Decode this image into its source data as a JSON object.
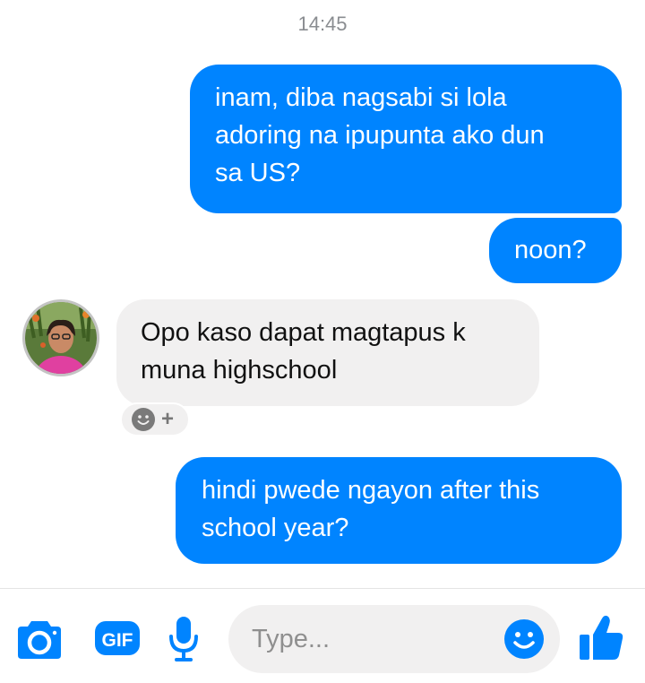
{
  "conversation": {
    "timestamp": "14:45",
    "messages": [
      {
        "direction": "outgoing",
        "lines": [
          "inam, diba nagsabi si lola",
          "adoring na ipupunta ako dun",
          "sa US?"
        ]
      },
      {
        "direction": "outgoing",
        "lines": [
          "noon?"
        ]
      },
      {
        "direction": "incoming",
        "lines": [
          "Opo kaso dapat magtapus k",
          "muna highschool"
        ]
      },
      {
        "direction": "outgoing",
        "lines": [
          "hindi pwede ngayon after this",
          "school year?"
        ]
      }
    ],
    "reaction_add_label": "+"
  },
  "composer": {
    "placeholder": "Type...",
    "gif_label": "GIF",
    "icons": [
      "camera-icon",
      "gif-icon",
      "microphone-icon",
      "emoji-icon",
      "thumbs-up-icon"
    ]
  },
  "colors": {
    "accent": "#0084ff",
    "incoming_bubble": "#f1f0f0",
    "timestamp": "#8a8d91"
  }
}
